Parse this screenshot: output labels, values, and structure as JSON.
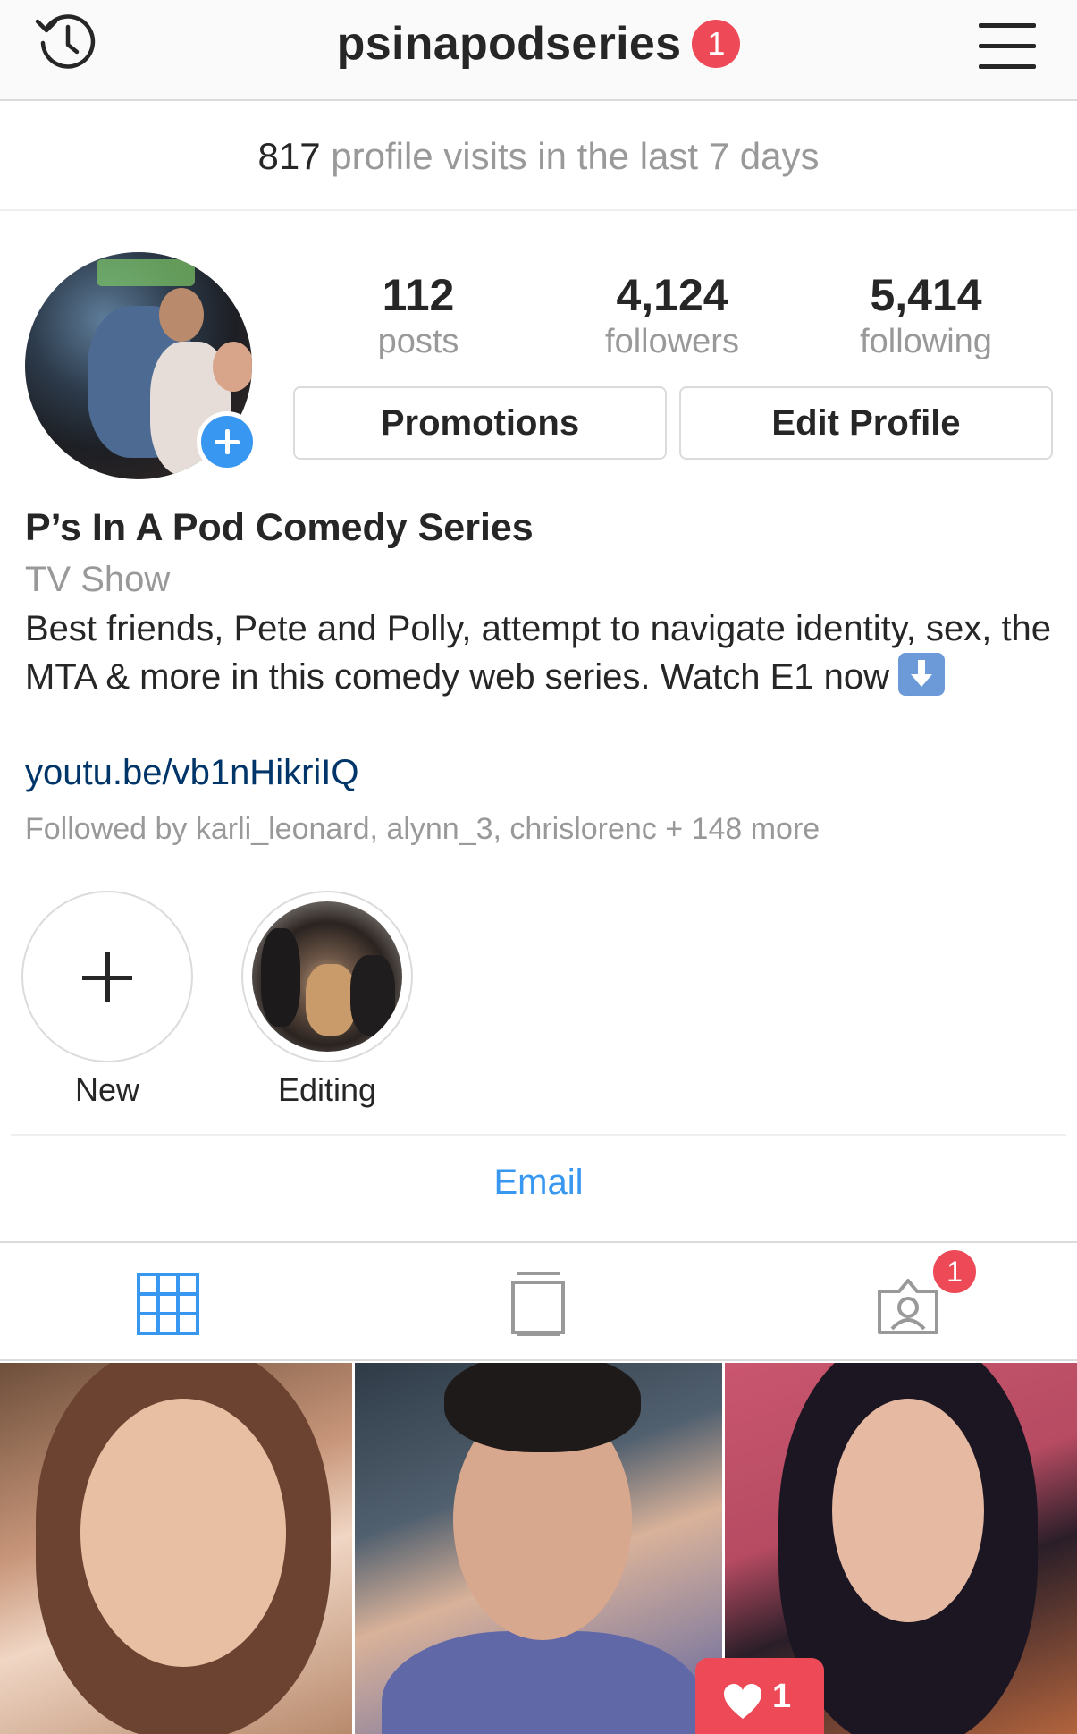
{
  "topbar": {
    "username": "psinapodseries",
    "notification_count": "1"
  },
  "insights": {
    "visits_count": "817",
    "visits_label": "profile visits in the last 7 days"
  },
  "stats": [
    {
      "value": "112",
      "label": "posts"
    },
    {
      "value": "4,124",
      "label": "followers"
    },
    {
      "value": "5,414",
      "label": "following"
    }
  ],
  "buttons": {
    "promotions": "Promotions",
    "edit_profile": "Edit Profile",
    "email": "Email"
  },
  "profile": {
    "name": "P’s In A Pod Comedy Series",
    "category": "TV Show",
    "bio": "Best friends, Pete and Polly, attempt to navigate identity, sex, the MTA & more in this comedy web series. Watch E1 now",
    "bio_emoji": "down-arrow-emoji",
    "link": "youtu.be/vb1nHikriIQ",
    "followed_by": "Followed by karli_leonard, alynn_3, chrislorenc + 148 more"
  },
  "highlights": [
    {
      "label": "New",
      "type": "add"
    },
    {
      "label": "Editing",
      "type": "story"
    }
  ],
  "tabs": {
    "active": "grid",
    "items": [
      "grid-icon",
      "feed-icon",
      "tagged-icon"
    ],
    "tagged_badge": "1"
  },
  "posts": [
    {
      "subject": "woman-smiling-headshot"
    },
    {
      "subject": "man-smiling-headshot"
    },
    {
      "subject": "woman-hands-on-face"
    }
  ],
  "activity": {
    "likes_count": "1"
  },
  "colors": {
    "accent": "#3897f0",
    "badge": "#ed4956",
    "link": "#003569",
    "muted": "#999999"
  }
}
